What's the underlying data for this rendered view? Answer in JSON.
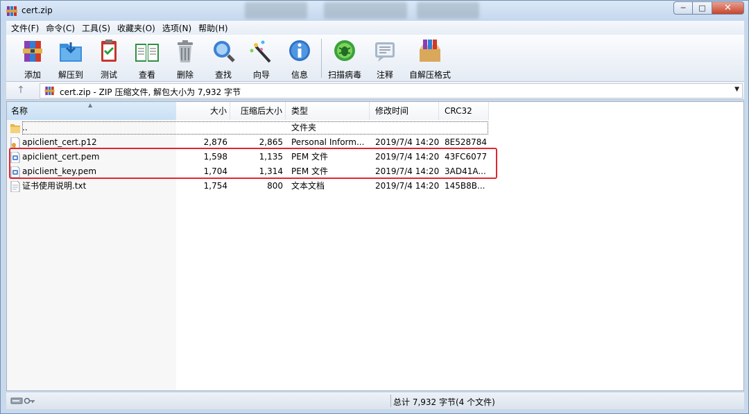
{
  "window": {
    "title": "cert.zip",
    "buttons": {
      "minimize": "─",
      "maximize": "□",
      "close": "✕"
    }
  },
  "menu": [
    "文件(F)",
    "命令(C)",
    "工具(S)",
    "收藏夹(O)",
    "选项(N)",
    "帮助(H)"
  ],
  "toolbar": [
    {
      "label": "添加",
      "icon": "add-archive-icon"
    },
    {
      "label": "解压到",
      "icon": "extract-to-icon"
    },
    {
      "label": "测试",
      "icon": "test-icon"
    },
    {
      "label": "查看",
      "icon": "view-icon"
    },
    {
      "label": "删除",
      "icon": "delete-icon"
    },
    {
      "label": "查找",
      "icon": "find-icon"
    },
    {
      "label": "向导",
      "icon": "wizard-icon"
    },
    {
      "label": "信息",
      "icon": "info-icon"
    },
    {
      "label": "扫描病毒",
      "icon": "virus-scan-icon"
    },
    {
      "label": "注释",
      "icon": "comment-icon"
    },
    {
      "label": "自解压格式",
      "icon": "sfx-icon"
    }
  ],
  "address": {
    "up": "↑",
    "text": "cert.zip - ZIP 压缩文件, 解包大小为 7,932 字节",
    "dropdown": "▼"
  },
  "columns": {
    "name": "名称",
    "size": "大小",
    "packed": "压缩后大小",
    "type": "类型",
    "modified": "修改时间",
    "crc": "CRC32"
  },
  "files": [
    {
      "name": "..",
      "size": "",
      "packed": "",
      "type": "文件夹",
      "modified": "",
      "crc": "",
      "icon": "folder-icon"
    },
    {
      "name": "apiclient_cert.p12",
      "size": "2,876",
      "packed": "2,865",
      "type": "Personal Inform...",
      "modified": "2019/7/4 14:20",
      "crc": "8E528784",
      "icon": "certificate-file-icon"
    },
    {
      "name": "apiclient_cert.pem",
      "size": "1,598",
      "packed": "1,135",
      "type": "PEM 文件",
      "modified": "2019/7/4 14:20",
      "crc": "43FC6077",
      "icon": "pem-file-icon"
    },
    {
      "name": "apiclient_key.pem",
      "size": "1,704",
      "packed": "1,314",
      "type": "PEM 文件",
      "modified": "2019/7/4 14:20",
      "crc": "3AD41A...",
      "icon": "pem-file-icon"
    },
    {
      "name": "证书使用说明.txt",
      "size": "1,754",
      "packed": "800",
      "type": "文本文档",
      "modified": "2019/7/4 14:20",
      "crc": "145B8B...",
      "icon": "text-file-icon"
    }
  ],
  "status": {
    "summary": "总计 7,932 字节(4 个文件)"
  },
  "colors": {
    "highlight": "#e0262f",
    "titlebar": "#c9d9ec"
  }
}
